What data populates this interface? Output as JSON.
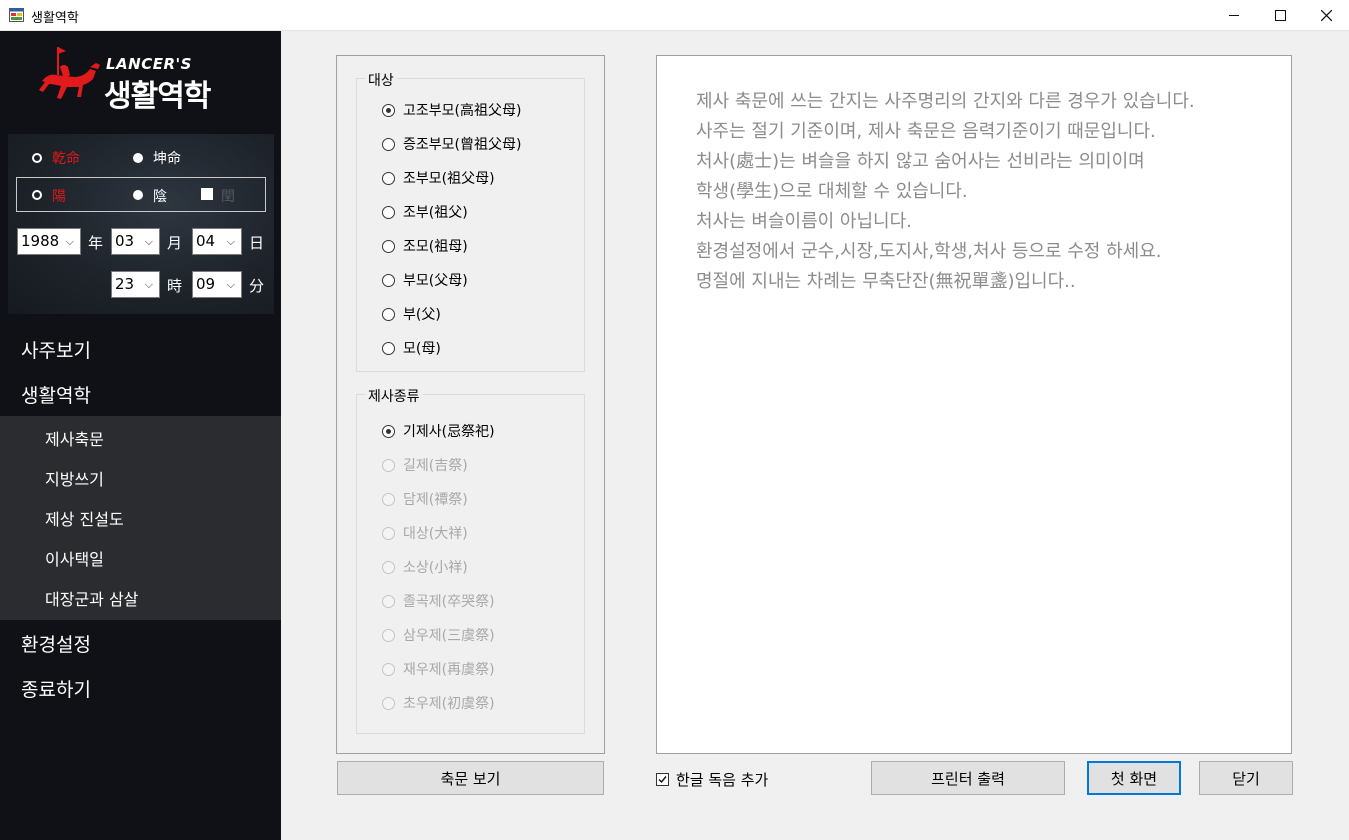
{
  "window": {
    "title": "생활역학",
    "min_icon": "minimize-icon",
    "max_icon": "maximize-icon",
    "close_icon": "close-icon"
  },
  "logo": {
    "line1": "LANCER'S",
    "line2": "생활역학",
    "emblem": "horse-rider-icon"
  },
  "birth": {
    "gender_male": "乾命",
    "gender_female": "坤命",
    "calendar_solar": "陽",
    "calendar_lunar": "陰",
    "leap_month": "閏",
    "year": "1988",
    "year_unit": "年",
    "month": "03",
    "month_unit": "月",
    "day": "04",
    "day_unit": "日",
    "hour": "23",
    "hour_unit": "時",
    "minute": "09",
    "minute_unit": "分"
  },
  "menu": {
    "saju": "사주보기",
    "life": "생활역학",
    "sub": [
      "제사축문",
      "지방쓰기",
      "제상 진설도",
      "이사택일",
      "대장군과 삼살"
    ],
    "settings": "환경설정",
    "exit": "종료하기"
  },
  "target_group": {
    "legend": "대상",
    "options": [
      "고조부모(高祖父母)",
      "증조부모(曾祖父母)",
      "조부모(祖父母)",
      "조부(祖父)",
      "조모(祖母)",
      "부모(父母)",
      "부(父)",
      "모(母)"
    ],
    "selected": 0
  },
  "rite_group": {
    "legend": "제사종류",
    "options": [
      "기제사(忌祭祀)",
      "길제(吉祭)",
      "담제(禫祭)",
      "대상(大祥)",
      "소상(小祥)",
      "졸곡제(卒哭祭)",
      "삼우제(三虞祭)",
      "재우제(再虞祭)",
      "초우제(初虞祭)"
    ],
    "selected": 0
  },
  "info_text": [
    "제사 축문에 쓰는 간지는 사주명리의 간지와 다른 경우가 있습니다.",
    "사주는 절기 기준이며, 제사 축문은 음력기준이기 때문입니다.",
    "처사(處士)는 벼슬을 하지 않고 숨어사는 선비라는 의미이며",
    "학생(學生)으로 대체할 수 있습니다.",
    "처사는 벼슬이름이 아닙니다.",
    "환경설정에서 군수,시장,도지사,학생,처사 등으로 수정 하세요.",
    "명절에 지내는 차례는 무축단잔(無祝單盞)입니다.."
  ],
  "buttons": {
    "view": "축문 보기",
    "hangul_check": "한글 독음 추가",
    "print": "프린터 출력",
    "home": "첫 화면",
    "close": "닫기"
  },
  "colors": {
    "sidebar_bg": "#0f1116",
    "submenu_bg": "#2b2c30",
    "accent_red": "#e01818",
    "focus_blue": "#0078d7"
  }
}
